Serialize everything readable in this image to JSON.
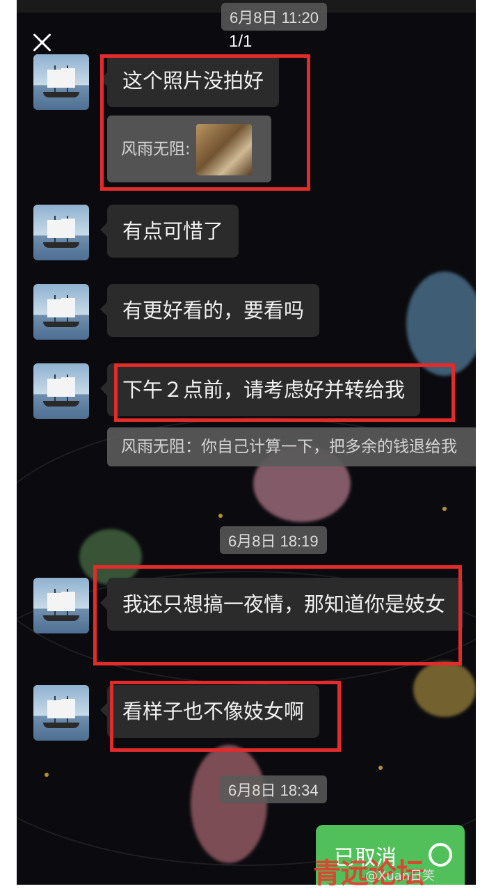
{
  "header": {
    "top_time": "6月8日 11:20",
    "pager": "1/1"
  },
  "messages": [
    {
      "text": "这个照片没拍好"
    },
    {
      "quote_name": "风雨无阻:",
      "quote_has_image": true
    },
    {
      "text": "有点可惜了"
    },
    {
      "text": "有更好看的，要看吗"
    },
    {
      "text": "下午２点前，请考虑好并转给我"
    },
    {
      "quote": "风雨无阻：你自己计算一下，把多余的钱退给我"
    },
    {
      "text": "我还只想搞一夜情，那知道你是妓女"
    },
    {
      "text": "看样子也不像妓女啊"
    }
  ],
  "timestamps": [
    "6月8日 18:19",
    "6月8日 18:34"
  ],
  "call_button": {
    "label": "已取消"
  },
  "watermark": {
    "text": "青远论坛",
    "small": "@Xuan日笑"
  },
  "colors": {
    "highlight": "#e22b2b",
    "bubble": "#2b2b2b",
    "green": "#52c05a"
  }
}
